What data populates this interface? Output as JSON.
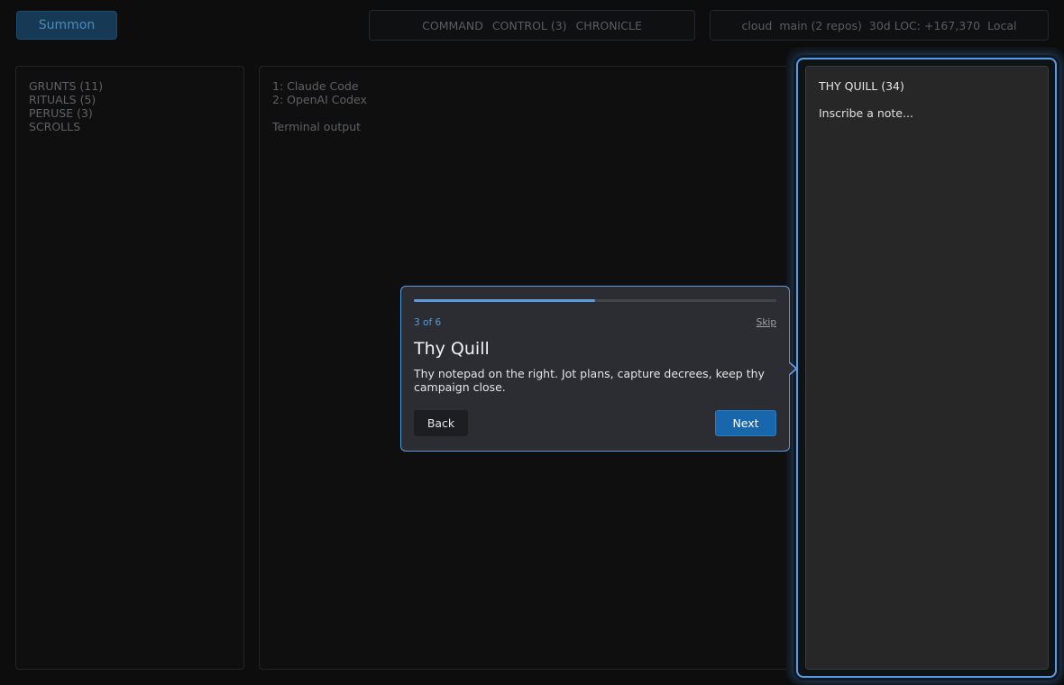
{
  "topbar": {
    "summon_label": "Summon",
    "nav": [
      "COMMAND",
      "CONTROL (3)",
      "CHRONICLE"
    ],
    "status": {
      "env": "cloud",
      "branch": "main (2 repos)",
      "loc": "30d LOC: +167,370",
      "mode": "Local"
    }
  },
  "sidebar": {
    "items": [
      "GRUNTS (11)",
      "RITUALS (5)",
      "PERUSE (3)",
      "SCROLLS"
    ]
  },
  "main": {
    "agents": [
      "1: Claude Code",
      "2: OpenAI Codex"
    ],
    "terminal_label": "Terminal output"
  },
  "quill": {
    "title": "THY QUILL (34)",
    "placeholder": "Inscribe a note..."
  },
  "tour": {
    "step_label": "3 of 6",
    "step_current": 3,
    "step_total": 6,
    "skip_label": "Skip",
    "title": "Thy Quill",
    "body": "Thy notepad on the right. Jot plans, capture decrees, keep thy campaign close.",
    "back_label": "Back",
    "next_label": "Next"
  },
  "colors": {
    "accent": "#5a9be0",
    "primary_button": "#1867ad",
    "summon_button": "#163a55"
  }
}
